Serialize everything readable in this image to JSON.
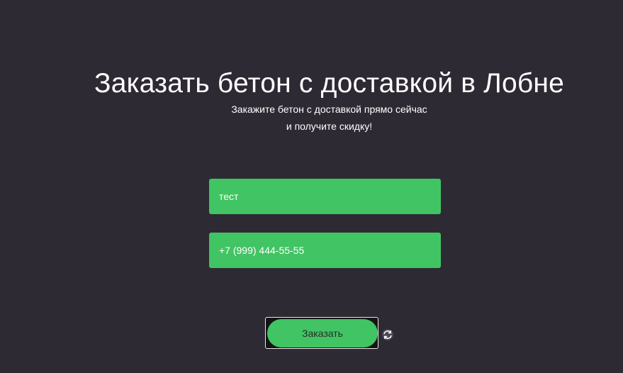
{
  "heading": "Заказать бетон с доставкой в Лобне",
  "subtitle": {
    "line1": "Закажите бетон с доставкой прямо сейчас",
    "line2": "и получите скидку!"
  },
  "form": {
    "name_value": "тест",
    "phone_value": "+7 (999) 444-55-55",
    "submit_label": "Заказать"
  },
  "icons": {
    "refresh": "refresh-icon"
  },
  "colors": {
    "background": "#2e2a33",
    "accent": "#41c463",
    "text": "#ffffff"
  }
}
